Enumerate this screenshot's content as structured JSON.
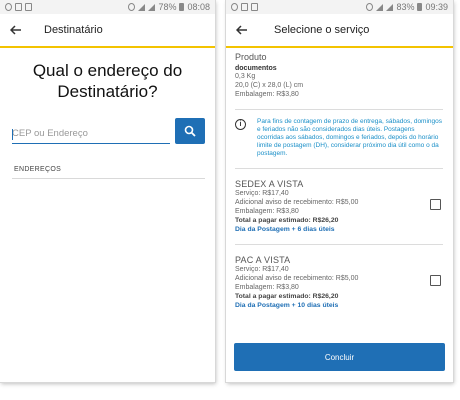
{
  "left": {
    "status": {
      "battery": "78%",
      "time": "08:08"
    },
    "title": "Destinatário",
    "heading": "Qual o endereço do Destinatário?",
    "search_placeholder": "CEP ou Endereço",
    "section_label": "ENDEREÇOS"
  },
  "right": {
    "status": {
      "battery": "83%",
      "time": "09:39"
    },
    "title": "Selecione o serviço",
    "product": {
      "title": "Produto",
      "type": "documentos",
      "weight": "0,3 Kg",
      "dimensions": "20,0 (C) x 28,0 (L) cm",
      "packaging": "Embalagem: R$3,80"
    },
    "info": "Para fins de contagem de prazo de entrega, sábados, domingos e feriados não são considerados dias úteis. Postagens ocorridas aos sábados, domingos e feriados, depois do horário limite de postagem (DH), considerar próximo dia útil como o da postagem.",
    "services": [
      {
        "name": "SEDEX A VISTA",
        "service": "Serviço: R$17,40",
        "additional": "Adicional aviso de recebimento: R$5,00",
        "packaging": "Embalagem: R$3,80",
        "total": "Total a pagar estimado: R$26,20",
        "days": "Dia da Postagem + 6 dias úteis"
      },
      {
        "name": "PAC A VISTA",
        "service": "Serviço: R$17,40",
        "additional": "Adicional aviso de recebimento: R$5,00",
        "packaging": "Embalagem: R$3,80",
        "total": "Total a pagar estimado: R$26,20",
        "days": "Dia da Postagem + 10 dias úteis"
      }
    ],
    "button": "Concluir"
  },
  "colors": {
    "accent_blue": "#1f6fb5",
    "accent_yellow": "#f3c300",
    "info_blue": "#1a8fc8"
  }
}
